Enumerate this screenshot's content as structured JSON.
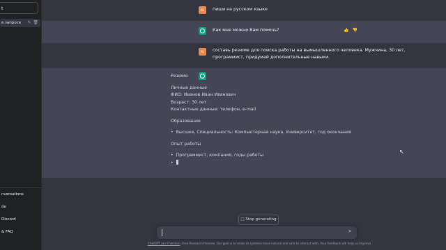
{
  "sidebar": {
    "new_chat": "t",
    "conversation": "в запросе",
    "conversation_icons": [
      "✎",
      "🗑"
    ],
    "menu": [
      "nversations",
      "de",
      "Discord",
      "& FAQ"
    ]
  },
  "messages": [
    {
      "role": "user",
      "text": "пиши на русском языке",
      "avatar_text": "RL"
    },
    {
      "role": "assistant",
      "text": "Как мне можно Вам помочь?"
    },
    {
      "role": "user",
      "line1": "составь резюме для поиска работы на вымышленного человека. Мужчина, 30 лет,",
      "line2": "программист, придумай дополнительные навыки.",
      "avatar_text": "RL"
    }
  ],
  "resume": {
    "title": "Резюме",
    "personal_heading": "Личные данные",
    "fio": "ФИО: Иванов Иван Иванович",
    "age": "Возраст: 30 лет",
    "contacts": "Контактные данные: телефон, e-mail",
    "education_heading": "Образование",
    "education_item": "Высшее, Специальность: Компьютерная наука, Университет, год окончания",
    "experience_heading": "Опыт работы",
    "experience_item": "Программист, компания, годы работы"
  },
  "controls": {
    "stop_label": "Stop generating",
    "stop_icon": "□",
    "send_icon": "➤",
    "thumbs": [
      "👍",
      "👎"
    ]
  },
  "footer": {
    "link": "ChatGPT Jan 9 Version",
    "text": ". Free Research Preview. Our goal is to make AI systems more natural and safe to interact with. Your feedback will help us improve."
  }
}
